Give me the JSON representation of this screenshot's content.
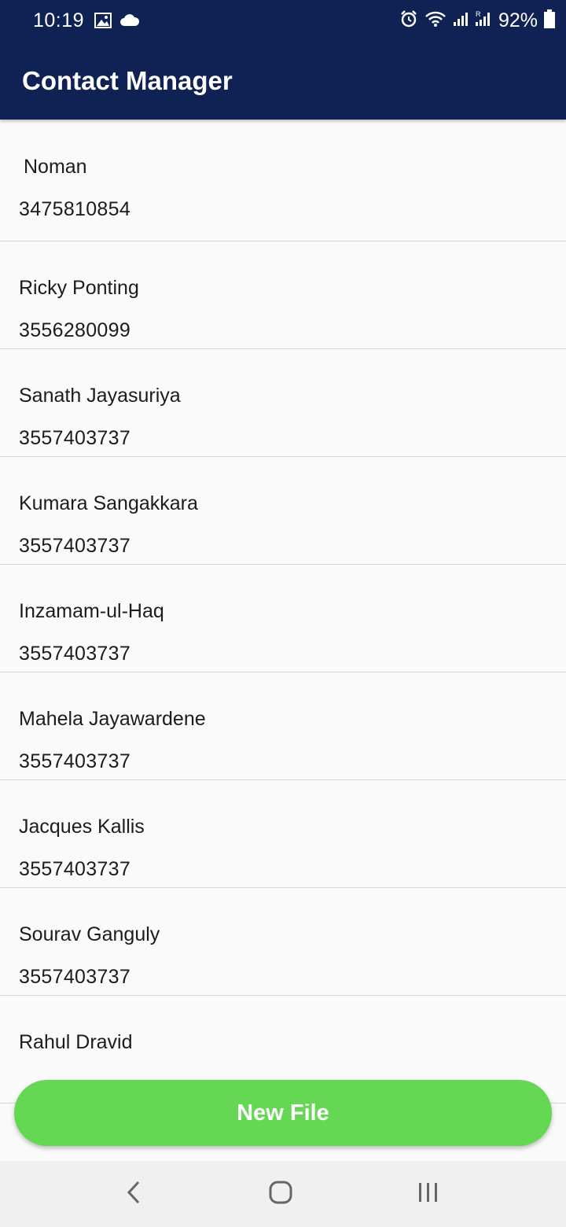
{
  "status_bar": {
    "time": "10:19",
    "battery_percent": "92%",
    "icons": [
      "image-icon",
      "cloud-icon",
      "alarm-icon",
      "wifi-icon",
      "signal-icon",
      "signal-roaming-icon",
      "battery-icon"
    ]
  },
  "app": {
    "title": "Contact Manager"
  },
  "contacts": [
    {
      "name": "Noman",
      "phone": "3475810854"
    },
    {
      "name": "Ricky Ponting",
      "phone": "3556280099"
    },
    {
      "name": "Sanath Jayasuriya",
      "phone": "3557403737"
    },
    {
      "name": "Kumara Sangakkara",
      "phone": "3557403737"
    },
    {
      "name": "Inzamam-ul-Haq",
      "phone": "3557403737"
    },
    {
      "name": "Mahela Jayawardene",
      "phone": "3557403737"
    },
    {
      "name": "Jacques Kallis",
      "phone": "3557403737"
    },
    {
      "name": "Sourav Ganguly",
      "phone": "3557403737"
    },
    {
      "name": "Rahul Dravid",
      "phone": ""
    }
  ],
  "actions": {
    "new_file_label": "New File"
  },
  "colors": {
    "app_bar": "#102254",
    "button": "#66d655",
    "background": "#fafafa"
  },
  "nav_bar": {
    "icons": [
      "back-icon",
      "home-icon",
      "recents-icon"
    ]
  }
}
